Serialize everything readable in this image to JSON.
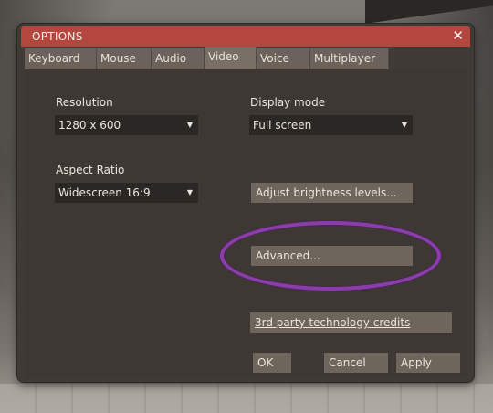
{
  "window": {
    "title": "OPTIONS",
    "close_glyph": "✕"
  },
  "tabs": [
    {
      "label": "Keyboard"
    },
    {
      "label": "Mouse"
    },
    {
      "label": "Audio"
    },
    {
      "label": "Video",
      "active": true
    },
    {
      "label": "Voice"
    },
    {
      "label": "Multiplayer"
    }
  ],
  "video": {
    "resolution": {
      "label": "Resolution",
      "value": "1280 x 600"
    },
    "display_mode": {
      "label": "Display mode",
      "value": "Full screen"
    },
    "aspect_ratio": {
      "label": "Aspect Ratio",
      "value": "Widescreen 16:9"
    },
    "adjust_brightness_label": "Adjust brightness levels...",
    "advanced_label": "Advanced...",
    "credits_label": "3rd party technology credits"
  },
  "footer": {
    "ok_label": "OK",
    "cancel_label": "Cancel",
    "apply_label": "Apply"
  },
  "colors": {
    "accent_title": "#b3463f",
    "highlight_ring": "#8a3fa8"
  },
  "icons": {
    "dropdown_arrow": "chevron-down-icon",
    "close": "close-icon"
  }
}
